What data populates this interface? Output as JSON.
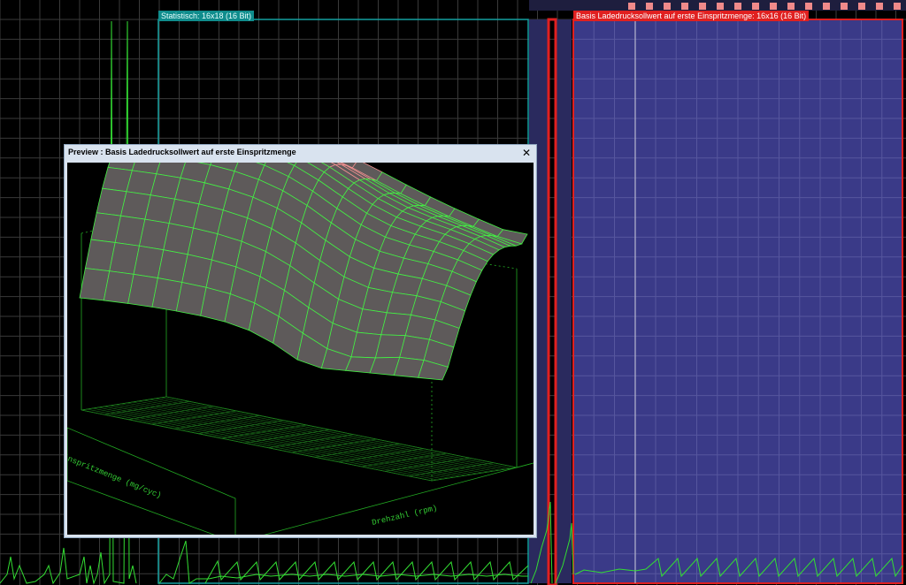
{
  "maps": {
    "statistic_label": "Statistisch: 16x18 (16 Bit)",
    "basis_label": "Basis Ladedrucksollwert auf erste Einspritzmenge: 16x16 (16 Bit)"
  },
  "preview": {
    "title": "Preview : Basis Ladedrucksollwert auf erste Einspritzmenge",
    "close_symbol": "✕",
    "axis_rpm_label": "Drehzahl (rpm)",
    "axis_injection_label": "Einspritzmenge (mg/cyc)"
  },
  "colors": {
    "background": "#000000",
    "grid": "#3c3c3c",
    "green_trace": "#33dd33",
    "teal_border": "#14a0a0",
    "red_border": "#e02020",
    "blue_map_fill": "#3a3a88",
    "preview_titlebar": "#d9e3ef",
    "surface_fill": "#5e5a5a",
    "surface_mesh_high": "#f09090",
    "surface_mesh_low": "#44ee44"
  }
}
